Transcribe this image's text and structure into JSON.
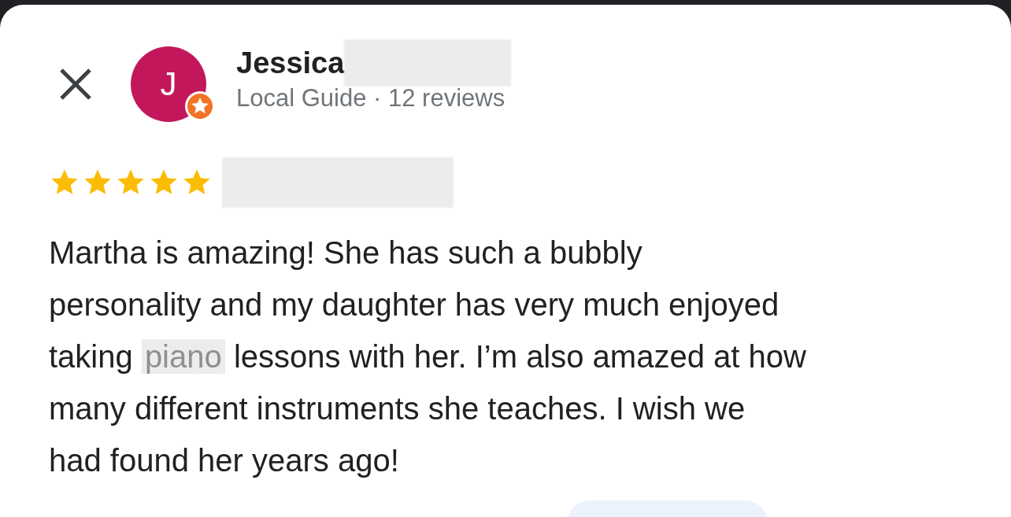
{
  "reviewer": {
    "initial": "J",
    "name": "Jessica",
    "subtitle": "Local Guide · 12 reviews"
  },
  "rating": {
    "stars": 5
  },
  "review_lines": [
    [
      {
        "kind": "text",
        "text": "Martha is amazing!  She has such a bubbly"
      }
    ],
    [
      {
        "kind": "text",
        "text": "personality and my daughter has very much enjoyed"
      }
    ],
    [
      {
        "kind": "text",
        "text": "taking"
      },
      {
        "kind": "blurred",
        "text": "piano"
      },
      {
        "kind": "text",
        "text": "lessons with her. I’m also amazed at how"
      }
    ],
    [
      {
        "kind": "text",
        "text": "many different instruments she teaches. I wish we"
      }
    ],
    [
      {
        "kind": "text",
        "text": "had found her years ago!"
      }
    ]
  ]
}
